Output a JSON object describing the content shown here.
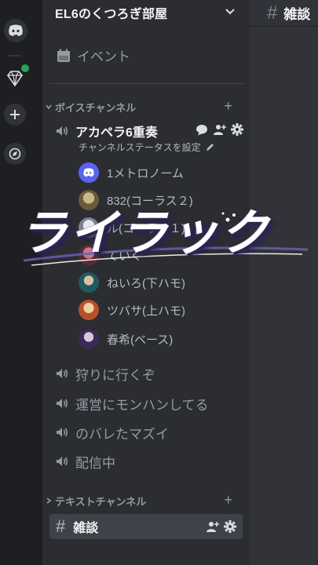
{
  "server": {
    "name": "EL6のくつろぎ部屋"
  },
  "events": {
    "label": "イベント"
  },
  "voice_category": {
    "label": "ボイスチャンネル"
  },
  "main_voice": {
    "name": "アカペラ6重奏",
    "status": "チャンネルステータスを設定",
    "members": [
      {
        "name": "1メトロノーム",
        "color": "#5865f2"
      },
      {
        "name": "832(コーラス２)",
        "color": "#8a7b5a"
      },
      {
        "name": "ル(コーラス１)",
        "color": "#9aa0b0"
      },
      {
        "name": "ていく",
        "color": "#7a3a4a"
      },
      {
        "name": "ねいろ(下ハモ)",
        "color": "#2f6b6e"
      },
      {
        "name": "ツバサ(上ハモ)",
        "color": "#b85a3a"
      },
      {
        "name": "春希(ベース)",
        "color": "#4a3a6a"
      }
    ]
  },
  "voice_channels": [
    "狩りに行くぞ",
    "運営にモンハンしてる",
    "のバレたマズイ",
    "配信中"
  ],
  "text_category": {
    "label": "テキストチャンネル"
  },
  "text_channels": [
    {
      "name": "雑談"
    }
  ],
  "main_header": {
    "title": "雑談"
  },
  "overlay": {
    "text": "ライラック"
  },
  "colors": {
    "accent": "#5865f2",
    "notify_green": "#23a559"
  }
}
